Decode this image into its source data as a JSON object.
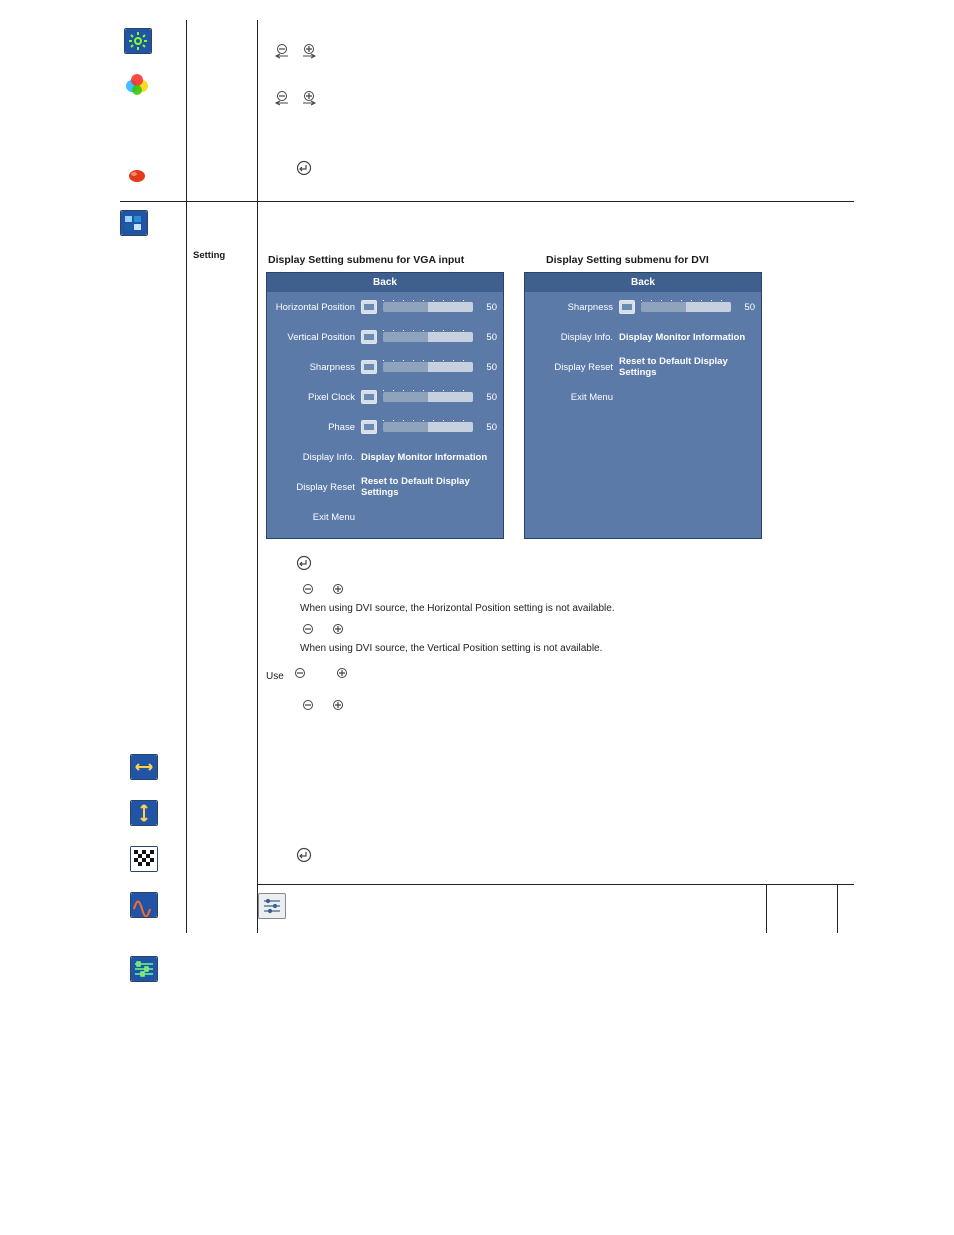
{
  "left_icons": {
    "set1": [
      "brightness-icon",
      "color-wheel-icon",
      "red-blob-icon"
    ],
    "set2": [
      "display-setting-icon",
      "horiz-pos-icon",
      "vert-pos-icon",
      "sharpness-icon",
      "pixel-clock-icon",
      "phase-icon",
      "other-settings-icon"
    ]
  },
  "row_label": "Setting",
  "vga_title": "Display Setting  submenu for VGA input",
  "dvi_title": "Display Setting  submenu for DVI",
  "panel_vga": {
    "header": "Back",
    "rows": [
      {
        "label": "Horizontal Position",
        "type": "slider",
        "val": "50"
      },
      {
        "label": "Vertical Position",
        "type": "slider",
        "val": "50"
      },
      {
        "label": "Sharpness",
        "type": "slider",
        "val": "50"
      },
      {
        "label": "Pixel Clock",
        "type": "slider",
        "val": "50"
      },
      {
        "label": "Phase",
        "type": "slider",
        "val": "50"
      },
      {
        "label": "Display Info.",
        "type": "action",
        "text": "Display Monitor Information"
      },
      {
        "label": "Display Reset",
        "type": "action",
        "text": "Reset to Default Display Settings"
      },
      {
        "label": "Exit Menu",
        "type": "blank"
      }
    ]
  },
  "panel_dvi": {
    "header": "Back",
    "rows": [
      {
        "label": "Sharpness",
        "type": "slider",
        "val": "50"
      },
      {
        "label": "Display Info.",
        "type": "action",
        "text": "Display Monitor Information"
      },
      {
        "label": "Display Reset",
        "type": "action",
        "text": "Reset to Default Display Settings"
      },
      {
        "label": "Exit Menu",
        "type": "blank"
      }
    ]
  },
  "notes": {
    "horiz": "When using DVI source, the Horizontal Position setting is not available.",
    "vert": "When using DVI source, the Vertical Position setting is not available.",
    "use_prefix": "Use"
  }
}
